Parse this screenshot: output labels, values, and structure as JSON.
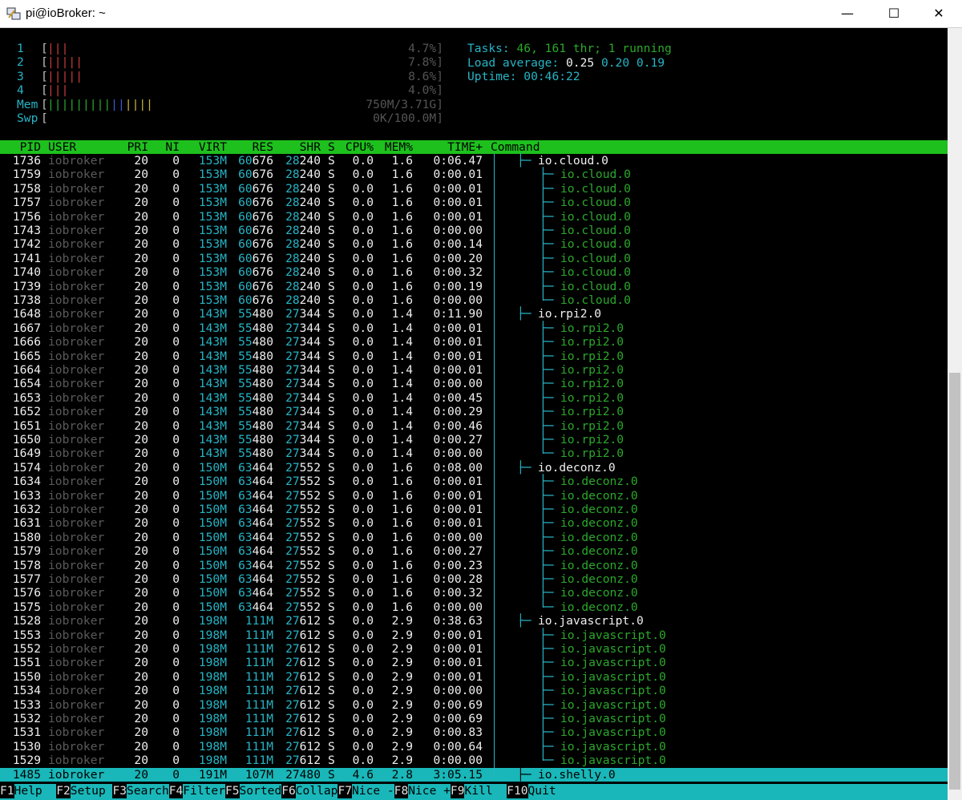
{
  "window": {
    "title": "pi@ioBroker: ~",
    "minimize_glyph": "—",
    "maximize_glyph": "☐",
    "close_glyph": "✕"
  },
  "meters": [
    {
      "label": "1",
      "bars": [
        [
          "red",
          "|"
        ],
        [
          "red",
          "|"
        ],
        [
          "red",
          "|"
        ]
      ],
      "value": "4.7%]"
    },
    {
      "label": "2",
      "bars": [
        [
          "red",
          "|"
        ],
        [
          "red",
          "|"
        ],
        [
          "red",
          "|"
        ],
        [
          "red",
          "|"
        ],
        [
          "red",
          "|"
        ]
      ],
      "value": "7.8%]"
    },
    {
      "label": "3",
      "bars": [
        [
          "red",
          "|"
        ],
        [
          "red",
          "|"
        ],
        [
          "red",
          "|"
        ],
        [
          "red",
          "|"
        ],
        [
          "red",
          "|"
        ]
      ],
      "value": "8.6%]"
    },
    {
      "label": "4",
      "bars": [
        [
          "red",
          "|"
        ],
        [
          "red",
          "|"
        ],
        [
          "red",
          "|"
        ]
      ],
      "value": "4.0%]"
    },
    {
      "label": "Mem",
      "bars": [
        [
          "green",
          "|"
        ],
        [
          "green",
          "|"
        ],
        [
          "green",
          "|"
        ],
        [
          "green",
          "|"
        ],
        [
          "green",
          "|"
        ],
        [
          "green",
          "|"
        ],
        [
          "green",
          "|"
        ],
        [
          "green",
          "|"
        ],
        [
          "green",
          "|"
        ],
        [
          "blue",
          "|"
        ],
        [
          "blue",
          "|"
        ],
        [
          "yellow",
          "|"
        ],
        [
          "yellow",
          "|"
        ],
        [
          "yellow",
          "|"
        ],
        [
          "yellow",
          "|"
        ]
      ],
      "value": "750M/3.71G]"
    },
    {
      "label": "Swp",
      "bars": [],
      "value": "0K/100.0M]"
    }
  ],
  "summary": {
    "tasks_label": "Tasks: ",
    "tasks_value": "46, 161 thr; 1 running",
    "load_label": "Load average: ",
    "load_1": "0.25",
    "load_5": "0.20",
    "load_15": "0.19",
    "uptime_label": "Uptime: ",
    "uptime_value": "00:46:22"
  },
  "columns": [
    "PID",
    "USER",
    "PRI",
    "NI",
    "VIRT",
    "RES",
    "SHR",
    "S",
    "CPU%",
    "MEM%",
    "TIME+",
    "Command"
  ],
  "processes": [
    {
      "pid": "1736",
      "user": "iobroker",
      "pri": "20",
      "ni": "0",
      "virt": "153M",
      "res": "60676",
      "shr": "28240",
      "s": "S",
      "cpu": "0.0",
      "mem": "1.6",
      "time": "0:06.47",
      "cmd": "io.cloud.0",
      "level": 0,
      "tree": "├─",
      "sel": false
    },
    {
      "pid": "1759",
      "user": "iobroker",
      "pri": "20",
      "ni": "0",
      "virt": "153M",
      "res": "60676",
      "shr": "28240",
      "s": "S",
      "cpu": "0.0",
      "mem": "1.6",
      "time": "0:00.01",
      "cmd": "io.cloud.0",
      "level": 1,
      "tree": "├─",
      "sel": false
    },
    {
      "pid": "1758",
      "user": "iobroker",
      "pri": "20",
      "ni": "0",
      "virt": "153M",
      "res": "60676",
      "shr": "28240",
      "s": "S",
      "cpu": "0.0",
      "mem": "1.6",
      "time": "0:00.01",
      "cmd": "io.cloud.0",
      "level": 1,
      "tree": "├─",
      "sel": false
    },
    {
      "pid": "1757",
      "user": "iobroker",
      "pri": "20",
      "ni": "0",
      "virt": "153M",
      "res": "60676",
      "shr": "28240",
      "s": "S",
      "cpu": "0.0",
      "mem": "1.6",
      "time": "0:00.01",
      "cmd": "io.cloud.0",
      "level": 1,
      "tree": "├─",
      "sel": false
    },
    {
      "pid": "1756",
      "user": "iobroker",
      "pri": "20",
      "ni": "0",
      "virt": "153M",
      "res": "60676",
      "shr": "28240",
      "s": "S",
      "cpu": "0.0",
      "mem": "1.6",
      "time": "0:00.01",
      "cmd": "io.cloud.0",
      "level": 1,
      "tree": "├─",
      "sel": false
    },
    {
      "pid": "1743",
      "user": "iobroker",
      "pri": "20",
      "ni": "0",
      "virt": "153M",
      "res": "60676",
      "shr": "28240",
      "s": "S",
      "cpu": "0.0",
      "mem": "1.6",
      "time": "0:00.00",
      "cmd": "io.cloud.0",
      "level": 1,
      "tree": "├─",
      "sel": false
    },
    {
      "pid": "1742",
      "user": "iobroker",
      "pri": "20",
      "ni": "0",
      "virt": "153M",
      "res": "60676",
      "shr": "28240",
      "s": "S",
      "cpu": "0.0",
      "mem": "1.6",
      "time": "0:00.14",
      "cmd": "io.cloud.0",
      "level": 1,
      "tree": "├─",
      "sel": false
    },
    {
      "pid": "1741",
      "user": "iobroker",
      "pri": "20",
      "ni": "0",
      "virt": "153M",
      "res": "60676",
      "shr": "28240",
      "s": "S",
      "cpu": "0.0",
      "mem": "1.6",
      "time": "0:00.20",
      "cmd": "io.cloud.0",
      "level": 1,
      "tree": "├─",
      "sel": false
    },
    {
      "pid": "1740",
      "user": "iobroker",
      "pri": "20",
      "ni": "0",
      "virt": "153M",
      "res": "60676",
      "shr": "28240",
      "s": "S",
      "cpu": "0.0",
      "mem": "1.6",
      "time": "0:00.32",
      "cmd": "io.cloud.0",
      "level": 1,
      "tree": "├─",
      "sel": false
    },
    {
      "pid": "1739",
      "user": "iobroker",
      "pri": "20",
      "ni": "0",
      "virt": "153M",
      "res": "60676",
      "shr": "28240",
      "s": "S",
      "cpu": "0.0",
      "mem": "1.6",
      "time": "0:00.19",
      "cmd": "io.cloud.0",
      "level": 1,
      "tree": "├─",
      "sel": false
    },
    {
      "pid": "1738",
      "user": "iobroker",
      "pri": "20",
      "ni": "0",
      "virt": "153M",
      "res": "60676",
      "shr": "28240",
      "s": "S",
      "cpu": "0.0",
      "mem": "1.6",
      "time": "0:00.00",
      "cmd": "io.cloud.0",
      "level": 1,
      "tree": "└─",
      "sel": false
    },
    {
      "pid": "1648",
      "user": "iobroker",
      "pri": "20",
      "ni": "0",
      "virt": "143M",
      "res": "55480",
      "shr": "27344",
      "s": "S",
      "cpu": "0.0",
      "mem": "1.4",
      "time": "0:11.90",
      "cmd": "io.rpi2.0",
      "level": 0,
      "tree": "├─",
      "sel": false
    },
    {
      "pid": "1667",
      "user": "iobroker",
      "pri": "20",
      "ni": "0",
      "virt": "143M",
      "res": "55480",
      "shr": "27344",
      "s": "S",
      "cpu": "0.0",
      "mem": "1.4",
      "time": "0:00.01",
      "cmd": "io.rpi2.0",
      "level": 1,
      "tree": "├─",
      "sel": false
    },
    {
      "pid": "1666",
      "user": "iobroker",
      "pri": "20",
      "ni": "0",
      "virt": "143M",
      "res": "55480",
      "shr": "27344",
      "s": "S",
      "cpu": "0.0",
      "mem": "1.4",
      "time": "0:00.01",
      "cmd": "io.rpi2.0",
      "level": 1,
      "tree": "├─",
      "sel": false
    },
    {
      "pid": "1665",
      "user": "iobroker",
      "pri": "20",
      "ni": "0",
      "virt": "143M",
      "res": "55480",
      "shr": "27344",
      "s": "S",
      "cpu": "0.0",
      "mem": "1.4",
      "time": "0:00.01",
      "cmd": "io.rpi2.0",
      "level": 1,
      "tree": "├─",
      "sel": false
    },
    {
      "pid": "1664",
      "user": "iobroker",
      "pri": "20",
      "ni": "0",
      "virt": "143M",
      "res": "55480",
      "shr": "27344",
      "s": "S",
      "cpu": "0.0",
      "mem": "1.4",
      "time": "0:00.01",
      "cmd": "io.rpi2.0",
      "level": 1,
      "tree": "├─",
      "sel": false
    },
    {
      "pid": "1654",
      "user": "iobroker",
      "pri": "20",
      "ni": "0",
      "virt": "143M",
      "res": "55480",
      "shr": "27344",
      "s": "S",
      "cpu": "0.0",
      "mem": "1.4",
      "time": "0:00.00",
      "cmd": "io.rpi2.0",
      "level": 1,
      "tree": "├─",
      "sel": false
    },
    {
      "pid": "1653",
      "user": "iobroker",
      "pri": "20",
      "ni": "0",
      "virt": "143M",
      "res": "55480",
      "shr": "27344",
      "s": "S",
      "cpu": "0.0",
      "mem": "1.4",
      "time": "0:00.45",
      "cmd": "io.rpi2.0",
      "level": 1,
      "tree": "├─",
      "sel": false
    },
    {
      "pid": "1652",
      "user": "iobroker",
      "pri": "20",
      "ni": "0",
      "virt": "143M",
      "res": "55480",
      "shr": "27344",
      "s": "S",
      "cpu": "0.0",
      "mem": "1.4",
      "time": "0:00.29",
      "cmd": "io.rpi2.0",
      "level": 1,
      "tree": "├─",
      "sel": false
    },
    {
      "pid": "1651",
      "user": "iobroker",
      "pri": "20",
      "ni": "0",
      "virt": "143M",
      "res": "55480",
      "shr": "27344",
      "s": "S",
      "cpu": "0.0",
      "mem": "1.4",
      "time": "0:00.46",
      "cmd": "io.rpi2.0",
      "level": 1,
      "tree": "├─",
      "sel": false
    },
    {
      "pid": "1650",
      "user": "iobroker",
      "pri": "20",
      "ni": "0",
      "virt": "143M",
      "res": "55480",
      "shr": "27344",
      "s": "S",
      "cpu": "0.0",
      "mem": "1.4",
      "time": "0:00.27",
      "cmd": "io.rpi2.0",
      "level": 1,
      "tree": "├─",
      "sel": false
    },
    {
      "pid": "1649",
      "user": "iobroker",
      "pri": "20",
      "ni": "0",
      "virt": "143M",
      "res": "55480",
      "shr": "27344",
      "s": "S",
      "cpu": "0.0",
      "mem": "1.4",
      "time": "0:00.00",
      "cmd": "io.rpi2.0",
      "level": 1,
      "tree": "└─",
      "sel": false
    },
    {
      "pid": "1574",
      "user": "iobroker",
      "pri": "20",
      "ni": "0",
      "virt": "150M",
      "res": "63464",
      "shr": "27552",
      "s": "S",
      "cpu": "0.0",
      "mem": "1.6",
      "time": "0:08.00",
      "cmd": "io.deconz.0",
      "level": 0,
      "tree": "├─",
      "sel": false
    },
    {
      "pid": "1634",
      "user": "iobroker",
      "pri": "20",
      "ni": "0",
      "virt": "150M",
      "res": "63464",
      "shr": "27552",
      "s": "S",
      "cpu": "0.0",
      "mem": "1.6",
      "time": "0:00.01",
      "cmd": "io.deconz.0",
      "level": 1,
      "tree": "├─",
      "sel": false
    },
    {
      "pid": "1633",
      "user": "iobroker",
      "pri": "20",
      "ni": "0",
      "virt": "150M",
      "res": "63464",
      "shr": "27552",
      "s": "S",
      "cpu": "0.0",
      "mem": "1.6",
      "time": "0:00.01",
      "cmd": "io.deconz.0",
      "level": 1,
      "tree": "├─",
      "sel": false
    },
    {
      "pid": "1632",
      "user": "iobroker",
      "pri": "20",
      "ni": "0",
      "virt": "150M",
      "res": "63464",
      "shr": "27552",
      "s": "S",
      "cpu": "0.0",
      "mem": "1.6",
      "time": "0:00.01",
      "cmd": "io.deconz.0",
      "level": 1,
      "tree": "├─",
      "sel": false
    },
    {
      "pid": "1631",
      "user": "iobroker",
      "pri": "20",
      "ni": "0",
      "virt": "150M",
      "res": "63464",
      "shr": "27552",
      "s": "S",
      "cpu": "0.0",
      "mem": "1.6",
      "time": "0:00.01",
      "cmd": "io.deconz.0",
      "level": 1,
      "tree": "├─",
      "sel": false
    },
    {
      "pid": "1580",
      "user": "iobroker",
      "pri": "20",
      "ni": "0",
      "virt": "150M",
      "res": "63464",
      "shr": "27552",
      "s": "S",
      "cpu": "0.0",
      "mem": "1.6",
      "time": "0:00.00",
      "cmd": "io.deconz.0",
      "level": 1,
      "tree": "├─",
      "sel": false
    },
    {
      "pid": "1579",
      "user": "iobroker",
      "pri": "20",
      "ni": "0",
      "virt": "150M",
      "res": "63464",
      "shr": "27552",
      "s": "S",
      "cpu": "0.0",
      "mem": "1.6",
      "time": "0:00.27",
      "cmd": "io.deconz.0",
      "level": 1,
      "tree": "├─",
      "sel": false
    },
    {
      "pid": "1578",
      "user": "iobroker",
      "pri": "20",
      "ni": "0",
      "virt": "150M",
      "res": "63464",
      "shr": "27552",
      "s": "S",
      "cpu": "0.0",
      "mem": "1.6",
      "time": "0:00.23",
      "cmd": "io.deconz.0",
      "level": 1,
      "tree": "├─",
      "sel": false
    },
    {
      "pid": "1577",
      "user": "iobroker",
      "pri": "20",
      "ni": "0",
      "virt": "150M",
      "res": "63464",
      "shr": "27552",
      "s": "S",
      "cpu": "0.0",
      "mem": "1.6",
      "time": "0:00.28",
      "cmd": "io.deconz.0",
      "level": 1,
      "tree": "├─",
      "sel": false
    },
    {
      "pid": "1576",
      "user": "iobroker",
      "pri": "20",
      "ni": "0",
      "virt": "150M",
      "res": "63464",
      "shr": "27552",
      "s": "S",
      "cpu": "0.0",
      "mem": "1.6",
      "time": "0:00.32",
      "cmd": "io.deconz.0",
      "level": 1,
      "tree": "├─",
      "sel": false
    },
    {
      "pid": "1575",
      "user": "iobroker",
      "pri": "20",
      "ni": "0",
      "virt": "150M",
      "res": "63464",
      "shr": "27552",
      "s": "S",
      "cpu": "0.0",
      "mem": "1.6",
      "time": "0:00.00",
      "cmd": "io.deconz.0",
      "level": 1,
      "tree": "└─",
      "sel": false
    },
    {
      "pid": "1528",
      "user": "iobroker",
      "pri": "20",
      "ni": "0",
      "virt": "198M",
      "res": "111M",
      "shr": "27612",
      "s": "S",
      "cpu": "0.0",
      "mem": "2.9",
      "time": "0:38.63",
      "cmd": "io.javascript.0",
      "level": 0,
      "tree": "├─",
      "sel": false
    },
    {
      "pid": "1553",
      "user": "iobroker",
      "pri": "20",
      "ni": "0",
      "virt": "198M",
      "res": "111M",
      "shr": "27612",
      "s": "S",
      "cpu": "0.0",
      "mem": "2.9",
      "time": "0:00.01",
      "cmd": "io.javascript.0",
      "level": 1,
      "tree": "├─",
      "sel": false
    },
    {
      "pid": "1552",
      "user": "iobroker",
      "pri": "20",
      "ni": "0",
      "virt": "198M",
      "res": "111M",
      "shr": "27612",
      "s": "S",
      "cpu": "0.0",
      "mem": "2.9",
      "time": "0:00.01",
      "cmd": "io.javascript.0",
      "level": 1,
      "tree": "├─",
      "sel": false
    },
    {
      "pid": "1551",
      "user": "iobroker",
      "pri": "20",
      "ni": "0",
      "virt": "198M",
      "res": "111M",
      "shr": "27612",
      "s": "S",
      "cpu": "0.0",
      "mem": "2.9",
      "time": "0:00.01",
      "cmd": "io.javascript.0",
      "level": 1,
      "tree": "├─",
      "sel": false
    },
    {
      "pid": "1550",
      "user": "iobroker",
      "pri": "20",
      "ni": "0",
      "virt": "198M",
      "res": "111M",
      "shr": "27612",
      "s": "S",
      "cpu": "0.0",
      "mem": "2.9",
      "time": "0:00.01",
      "cmd": "io.javascript.0",
      "level": 1,
      "tree": "├─",
      "sel": false
    },
    {
      "pid": "1534",
      "user": "iobroker",
      "pri": "20",
      "ni": "0",
      "virt": "198M",
      "res": "111M",
      "shr": "27612",
      "s": "S",
      "cpu": "0.0",
      "mem": "2.9",
      "time": "0:00.00",
      "cmd": "io.javascript.0",
      "level": 1,
      "tree": "├─",
      "sel": false
    },
    {
      "pid": "1533",
      "user": "iobroker",
      "pri": "20",
      "ni": "0",
      "virt": "198M",
      "res": "111M",
      "shr": "27612",
      "s": "S",
      "cpu": "0.0",
      "mem": "2.9",
      "time": "0:00.69",
      "cmd": "io.javascript.0",
      "level": 1,
      "tree": "├─",
      "sel": false
    },
    {
      "pid": "1532",
      "user": "iobroker",
      "pri": "20",
      "ni": "0",
      "virt": "198M",
      "res": "111M",
      "shr": "27612",
      "s": "S",
      "cpu": "0.0",
      "mem": "2.9",
      "time": "0:00.69",
      "cmd": "io.javascript.0",
      "level": 1,
      "tree": "├─",
      "sel": false
    },
    {
      "pid": "1531",
      "user": "iobroker",
      "pri": "20",
      "ni": "0",
      "virt": "198M",
      "res": "111M",
      "shr": "27612",
      "s": "S",
      "cpu": "0.0",
      "mem": "2.9",
      "time": "0:00.83",
      "cmd": "io.javascript.0",
      "level": 1,
      "tree": "├─",
      "sel": false
    },
    {
      "pid": "1530",
      "user": "iobroker",
      "pri": "20",
      "ni": "0",
      "virt": "198M",
      "res": "111M",
      "shr": "27612",
      "s": "S",
      "cpu": "0.0",
      "mem": "2.9",
      "time": "0:00.64",
      "cmd": "io.javascript.0",
      "level": 1,
      "tree": "├─",
      "sel": false
    },
    {
      "pid": "1529",
      "user": "iobroker",
      "pri": "20",
      "ni": "0",
      "virt": "198M",
      "res": "111M",
      "shr": "27612",
      "s": "S",
      "cpu": "0.0",
      "mem": "2.9",
      "time": "0:00.00",
      "cmd": "io.javascript.0",
      "level": 1,
      "tree": "└─",
      "sel": false
    },
    {
      "pid": "1485",
      "user": "iobroker",
      "pri": "20",
      "ni": "0",
      "virt": "191M",
      "res": "107M",
      "shr": "27480",
      "s": "S",
      "cpu": "4.6",
      "mem": "2.8",
      "time": "3:05.15",
      "cmd": "io.shelly.0",
      "level": 0,
      "tree": "├─",
      "sel": true
    }
  ],
  "function_keys": [
    {
      "key": "F1",
      "label": "Help"
    },
    {
      "key": "F2",
      "label": "Setup"
    },
    {
      "key": "F3",
      "label": "Search"
    },
    {
      "key": "F4",
      "label": "Filter"
    },
    {
      "key": "F5",
      "label": "Sorted"
    },
    {
      "key": "F6",
      "label": "Collap"
    },
    {
      "key": "F7",
      "label": "Nice -"
    },
    {
      "key": "F8",
      "label": "Nice +"
    },
    {
      "key": "F9",
      "label": "Kill"
    },
    {
      "key": "F10",
      "label": "Quit"
    }
  ],
  "colors": {
    "header_bg": "#1ec01e",
    "selection_bg": "#19b7b9",
    "cyan": "#26b5c6",
    "green": "#2ba82b"
  }
}
